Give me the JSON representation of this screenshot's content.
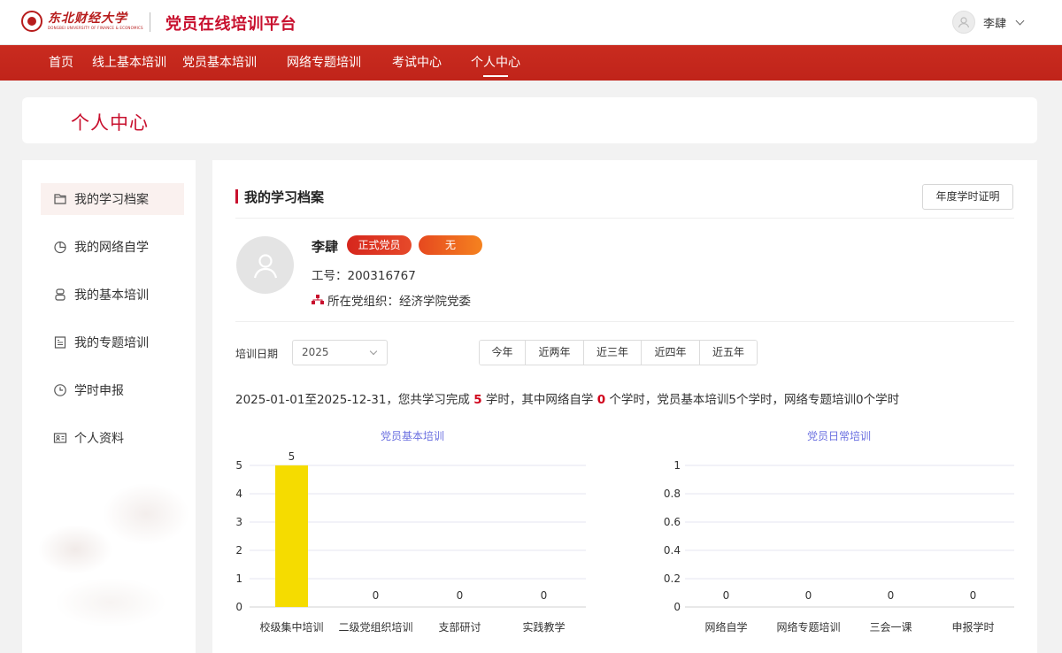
{
  "header": {
    "logo_cn": "东北财经大学",
    "logo_en": "DONGBEI UNIVERSITY OF FINANCE & ECONOMICS",
    "site_title": "党员在线培训平台",
    "user_name": "李肆"
  },
  "nav": {
    "items": [
      "首页",
      "线上基本培训",
      "党员基本培训",
      "网络专题培训",
      "考试中心",
      "个人中心"
    ],
    "active": "个人中心"
  },
  "page_title": "个人中心",
  "sidebar": {
    "items": [
      {
        "label": "我的学习档案",
        "icon": "folder-icon"
      },
      {
        "label": "我的网络自学",
        "icon": "pie-chart-icon"
      },
      {
        "label": "我的基本培训",
        "icon": "layers-icon"
      },
      {
        "label": "我的专题培训",
        "icon": "document-icon"
      },
      {
        "label": "学时申报",
        "icon": "clock-icon"
      },
      {
        "label": "个人资料",
        "icon": "id-card-icon"
      }
    ]
  },
  "profile": {
    "section_title": "我的学习档案",
    "cert_button": "年度学时证明",
    "name": "李肆",
    "badge_member": "正式党员",
    "badge_other": "无",
    "id_label": "工号：",
    "id_value": "200316767",
    "org_label": "所在党组织：",
    "org_value": "经济学院党委"
  },
  "filter": {
    "date_label": "培训日期",
    "year": "2025",
    "ranges": [
      "今年",
      "近两年",
      "近三年",
      "近四年",
      "近五年"
    ]
  },
  "summary": {
    "prefix": "2025-01-01至2025-12-31，您共学习完成",
    "total": "5",
    "mid1": "学时，其中网络自学",
    "online": "0",
    "suffix": "个学时，党员基本培训5个学时，网络专题培训0个学时"
  },
  "colors": {
    "brand_red": "#c8102e",
    "bar_yellow": "#f5dc00",
    "chart_title": "#6a6fe0"
  },
  "chart_data": [
    {
      "type": "bar",
      "title": "党员基本培训",
      "categories": [
        "校级集中培训",
        "二级党组织培训",
        "支部研讨",
        "实践教学"
      ],
      "values": [
        5,
        0,
        0,
        0
      ],
      "yticks": [
        "0",
        "1",
        "2",
        "3",
        "4",
        "5"
      ],
      "ylim": [
        0,
        5
      ],
      "grid": true
    },
    {
      "type": "bar",
      "title": "党员日常培训",
      "categories": [
        "网络自学",
        "网络专题培训",
        "三会一课",
        "申报学时"
      ],
      "values": [
        0,
        0,
        0,
        0
      ],
      "yticks": [
        "0",
        "0.2",
        "0.4",
        "0.6",
        "0.8",
        "1"
      ],
      "ylim": [
        0,
        1
      ],
      "grid": true
    }
  ]
}
